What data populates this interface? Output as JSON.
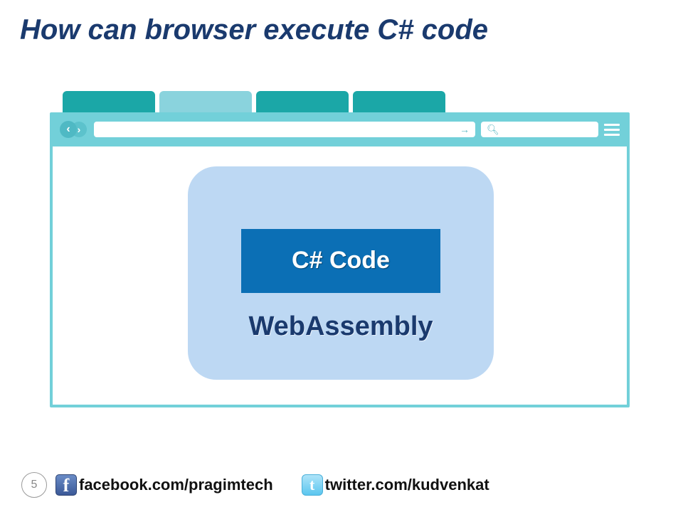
{
  "title": "How can browser execute C# code",
  "diagram": {
    "csharp_label": "C# Code",
    "wasm_label": "WebAssembly"
  },
  "footer": {
    "page_number": "5",
    "facebook": "facebook.com/pragimtech",
    "twitter": "twitter.com/kudvenkat"
  }
}
